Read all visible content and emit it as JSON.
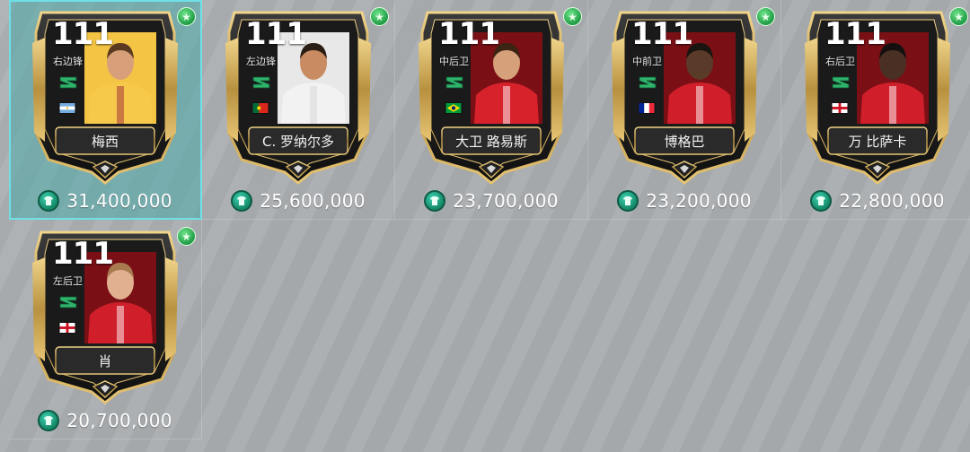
{
  "colors": {
    "background": "#a9adb0",
    "selected_bg": "#4daaaa",
    "selected_border": "#6fe0e6",
    "card_gold": "#c9a24a",
    "card_dark": "#1d1d1d",
    "coin": "#1fa67f",
    "star": "#2fbf5a"
  },
  "players": [
    {
      "rating": "111",
      "position": "右边锋",
      "name": "梅西",
      "price": "31,400,000",
      "flag": "argentina",
      "kit": {
        "main": "#f6c94a",
        "accent": "#a02a3a",
        "skin": "#d7a07a",
        "hair": "#5a3a20"
      },
      "selected": true
    },
    {
      "rating": "111",
      "position": "左边锋",
      "name": "C. 罗纳尔多",
      "price": "25,600,000",
      "flag": "portugal",
      "kit": {
        "main": "#f2f2f2",
        "accent": "#d6d6d6",
        "skin": "#c98b62",
        "hair": "#2a1d14"
      },
      "selected": false
    },
    {
      "rating": "111",
      "position": "中后卫",
      "name": "大卫 路易斯",
      "price": "23,700,000",
      "flag": "brazil",
      "kit": {
        "main": "#d7222c",
        "accent": "#ffffff",
        "skin": "#d6a07a",
        "hair": "#3a2414"
      },
      "selected": false
    },
    {
      "rating": "111",
      "position": "中前卫",
      "name": "博格巴",
      "price": "23,200,000",
      "flag": "france",
      "kit": {
        "main": "#d01f2a",
        "accent": "#ffffff",
        "skin": "#5a3a28",
        "hair": "#1a1410"
      },
      "selected": false
    },
    {
      "rating": "111",
      "position": "右后卫",
      "name": "万 比萨卡",
      "price": "22,800,000",
      "flag": "england",
      "kit": {
        "main": "#d01f2a",
        "accent": "#ffffff",
        "skin": "#4a3024",
        "hair": "#151010"
      },
      "selected": false
    },
    {
      "rating": "111",
      "position": "左后卫",
      "name": "肖",
      "price": "20,700,000",
      "flag": "england",
      "kit": {
        "main": "#d01f2a",
        "accent": "#ffffff",
        "skin": "#e0b090",
        "hair": "#a87a50"
      },
      "selected": false
    }
  ]
}
